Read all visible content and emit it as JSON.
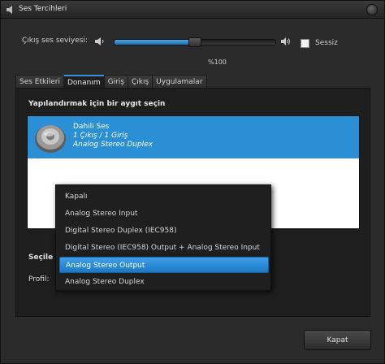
{
  "window": {
    "title": "Ses Tercihleri"
  },
  "volume": {
    "label": "Çıkış ses seviyesi:",
    "percent_text": "%100",
    "level": 0.5,
    "mute_label": "Sessiz",
    "mute_checked": false
  },
  "tabs": [
    {
      "label": "Ses Etkileri",
      "active": false
    },
    {
      "label": "Donanım",
      "active": true
    },
    {
      "label": "Giriş",
      "active": false
    },
    {
      "label": "Çıkış",
      "active": false
    },
    {
      "label": "Uygulamalar",
      "active": false
    }
  ],
  "hardware": {
    "section_title": "Yapılandırmak için bir aygıt seçin",
    "device": {
      "name": "Dahili Ses",
      "ports": "1 Çıkış / 1 Giriş",
      "profile": "Analog Stereo Duplex"
    },
    "settings_label": "Seçile",
    "profile_label": "Profil:"
  },
  "profile_menu": {
    "items": [
      {
        "label": "Kapalı",
        "selected": false
      },
      {
        "label": "Analog Stereo Input",
        "selected": false
      },
      {
        "label": "Digital Stereo Duplex (IEC958)",
        "selected": false
      },
      {
        "label": "Digital Stereo (IEC958) Output + Analog Stereo Input",
        "selected": false
      },
      {
        "label": "Analog Stereo Output",
        "selected": true
      },
      {
        "label": "Analog Stereo Duplex",
        "selected": false
      }
    ]
  },
  "footer": {
    "close_label": "Kapat"
  },
  "colors": {
    "accent": "#2b8fd6",
    "background": "#2b2b2b"
  },
  "icons": {
    "app": "speaker-icon",
    "volume_low": "volume-low-icon",
    "volume_high": "volume-high-icon",
    "device": "speaker-device-icon",
    "close": "close-icon"
  }
}
